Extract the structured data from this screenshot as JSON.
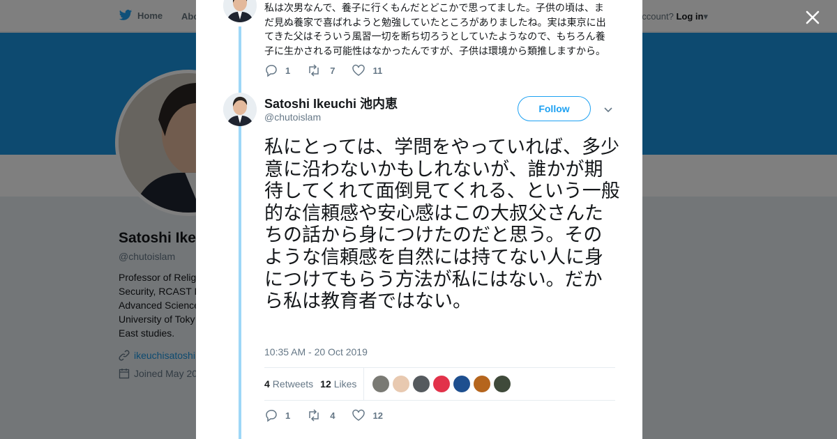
{
  "topbar": {
    "home_label": "Home",
    "about_label": "Abo",
    "account_prompt": "ccount?",
    "login_label": "Log in"
  },
  "profile": {
    "name": "Satoshi Ike",
    "handle": "@chutoislam",
    "bio_lines": "Professor of Relig\nSecurity, RCAST I\nAdvanced Science\nUniversity of Toky\nEast studies.",
    "link": "ikeuchisatoshi",
    "joined": "Joined May 20"
  },
  "previous_tweet": {
    "text": "私は次男なんで、養子に行くもんだとどこかで思ってました。子供の頃は、まだ見ぬ養家で喜ばれようと勉強していたところがありましたね。実は東京に出てきた父はそういう風習一切を断ち切ろうとしていたようなので、もちろん養子に生かされる可能性はなかったんですが、子供は環境から類推しますから。",
    "replies": "1",
    "retweets": "7",
    "likes": "11"
  },
  "tweet": {
    "author_name": "Satoshi Ikeuchi 池内恵",
    "author_handle": "@chutoislam",
    "follow_label": "Follow",
    "text": "私にとっては、学問をやっていれば、多少意に沿わないかもしれないが、誰かが期待してくれて面倒見てくれる、という一般的な信頼感や安心感はこの大叔父さんたちの話から身につけたのだと思う。そのような信頼感を自然には持てない人に身につけてもらう方法が私にはない。だから私は教育者ではない。",
    "timestamp": "10:35 AM - 20 Oct 2019",
    "retweet_count": "4",
    "retweet_label": "Retweets",
    "like_count": "12",
    "like_label": "Likes",
    "replies": "1",
    "retweets": "4",
    "likes": "12"
  },
  "icons": {
    "twitter": "twitter-bird-icon",
    "close": "close-icon",
    "reply": "reply-icon",
    "retweet": "retweet-icon",
    "like": "heart-icon",
    "caret": "chevron-down-icon",
    "link": "link-icon",
    "calendar": "calendar-icon"
  },
  "colors": {
    "brand": "#1da1f2",
    "banner": "#1b95e0",
    "thread_line": "#9ed7f7",
    "secondary_text": "#657786"
  }
}
